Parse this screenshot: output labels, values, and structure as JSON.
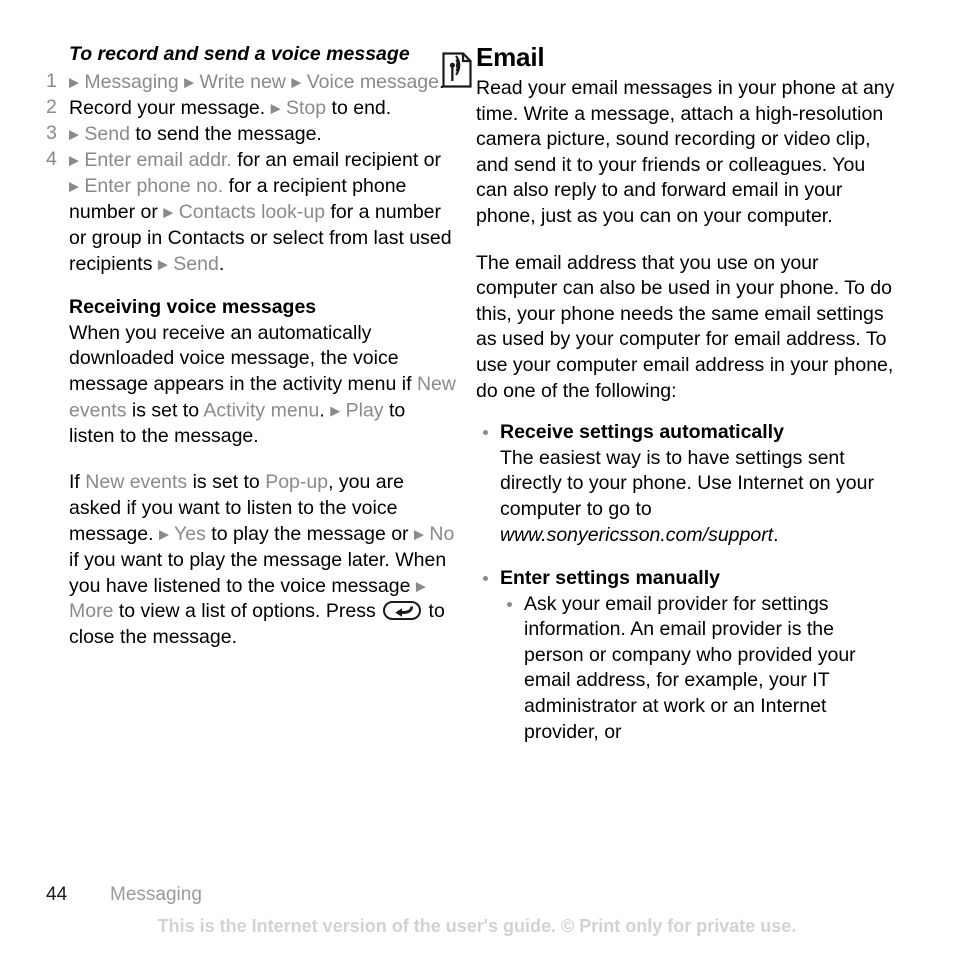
{
  "page": {
    "number": "44",
    "section": "Messaging",
    "disclaimer": "This is the Internet version of the user's guide. © Print only for private use."
  },
  "left_column": {
    "procedure_title": "To record and send a voice message",
    "steps": [
      {
        "number": "1",
        "parts": [
          {
            "text": "▶",
            "style": "arrow"
          },
          {
            "text": " Messaging ",
            "style": "highlight"
          },
          {
            "text": "▶",
            "style": "arrow"
          },
          {
            "text": " Write new ",
            "style": "highlight"
          },
          {
            "text": "▶",
            "style": "arrow"
          },
          {
            "text": " Voice message",
            "style": "highlight"
          },
          {
            "text": ".",
            "style": "normal"
          }
        ]
      },
      {
        "number": "2",
        "parts": [
          {
            "text": "Record your message. ",
            "style": "normal"
          },
          {
            "text": "▶",
            "style": "arrow"
          },
          {
            "text": " Stop",
            "style": "highlight"
          },
          {
            "text": " to end.",
            "style": "normal"
          }
        ]
      },
      {
        "number": "3",
        "parts": [
          {
            "text": "▶",
            "style": "arrow"
          },
          {
            "text": " Send",
            "style": "highlight"
          },
          {
            "text": " to send the message.",
            "style": "normal"
          }
        ]
      },
      {
        "number": "4",
        "parts": [
          {
            "text": "▶",
            "style": "arrow"
          },
          {
            "text": " Enter email addr.",
            "style": "highlight"
          },
          {
            "text": " for an email recipient or ",
            "style": "normal"
          },
          {
            "text": "▶",
            "style": "arrow"
          },
          {
            "text": " Enter phone no.",
            "style": "highlight"
          },
          {
            "text": " for a recipient phone number or ",
            "style": "normal"
          },
          {
            "text": "▶",
            "style": "arrow"
          },
          {
            "text": " Contacts look-up",
            "style": "highlight"
          },
          {
            "text": " for a number or group in Contacts or select from last used recipients ",
            "style": "normal"
          },
          {
            "text": "▶",
            "style": "arrow"
          },
          {
            "text": " Send",
            "style": "highlight"
          },
          {
            "text": ".",
            "style": "normal"
          }
        ]
      }
    ],
    "receiving_heading": "Receiving voice messages",
    "receiving_para": [
      {
        "text": "When you receive an automatically downloaded voice message, the voice message appears in the activity menu if ",
        "style": "normal"
      },
      {
        "text": "New events",
        "style": "highlight"
      },
      {
        "text": " is set to ",
        "style": "normal"
      },
      {
        "text": "Activity menu",
        "style": "highlight"
      },
      {
        "text": ". ",
        "style": "normal"
      },
      {
        "text": "▶",
        "style": "arrow"
      },
      {
        "text": " Play",
        "style": "highlight"
      },
      {
        "text": " to listen to the message.",
        "style": "normal"
      }
    ],
    "popup_para_before": [
      {
        "text": "If ",
        "style": "normal"
      },
      {
        "text": "New events",
        "style": "highlight"
      },
      {
        "text": " is set to ",
        "style": "normal"
      },
      {
        "text": "Pop-up",
        "style": "highlight"
      },
      {
        "text": ", you are asked if you want to listen to the voice message. ",
        "style": "normal"
      },
      {
        "text": "▶",
        "style": "arrow"
      },
      {
        "text": " Yes",
        "style": "highlight"
      },
      {
        "text": " to play the message or ",
        "style": "normal"
      },
      {
        "text": "▶",
        "style": "arrow"
      },
      {
        "text": " No",
        "style": "highlight"
      },
      {
        "text": " if you want to play the message later. When you have listened to the voice message ",
        "style": "normal"
      },
      {
        "text": "▶",
        "style": "arrow"
      },
      {
        "text": " More",
        "style": "highlight"
      },
      {
        "text": " to view a list of options. Press ",
        "style": "normal"
      }
    ],
    "popup_para_after": [
      {
        "text": " to close the message.",
        "style": "normal"
      }
    ],
    "back_key_icon": "back-key-icon"
  },
  "right_column": {
    "icon": "email-broadcast-icon",
    "title": "Email",
    "intro_para": "Read your email messages in your phone at any time. Write a message, attach a high-resolution camera picture, sound recording or video clip, and send it to your friends or colleagues. You can also reply to and forward email in your phone, just as you can on your computer.",
    "second_para": "The email address that you use on your computer can also be used in your phone. To do this, your phone needs the same email settings as used by your computer for email address. To use your computer email address in your phone, do one of the following:",
    "bullets": [
      {
        "heading": "Receive settings automatically",
        "body_parts": [
          {
            "text": "The easiest way is to have settings sent directly to your phone. Use Internet on your computer to go to ",
            "style": "normal"
          },
          {
            "text": "www.sonyericsson.com/support",
            "style": "italic"
          },
          {
            "text": ".",
            "style": "normal"
          }
        ]
      },
      {
        "heading": "Enter settings manually",
        "subbullets": [
          "Ask your email provider for settings information. An email provider is the person or company who provided your email address, for example, your IT administrator at work or an Internet provider, or"
        ]
      }
    ]
  },
  "colors": {
    "text": "#000000",
    "highlight_grey": "#8a8a8a",
    "footer_section_grey": "#9b9b9b",
    "disclaimer_grey": "#d2d2d2"
  }
}
